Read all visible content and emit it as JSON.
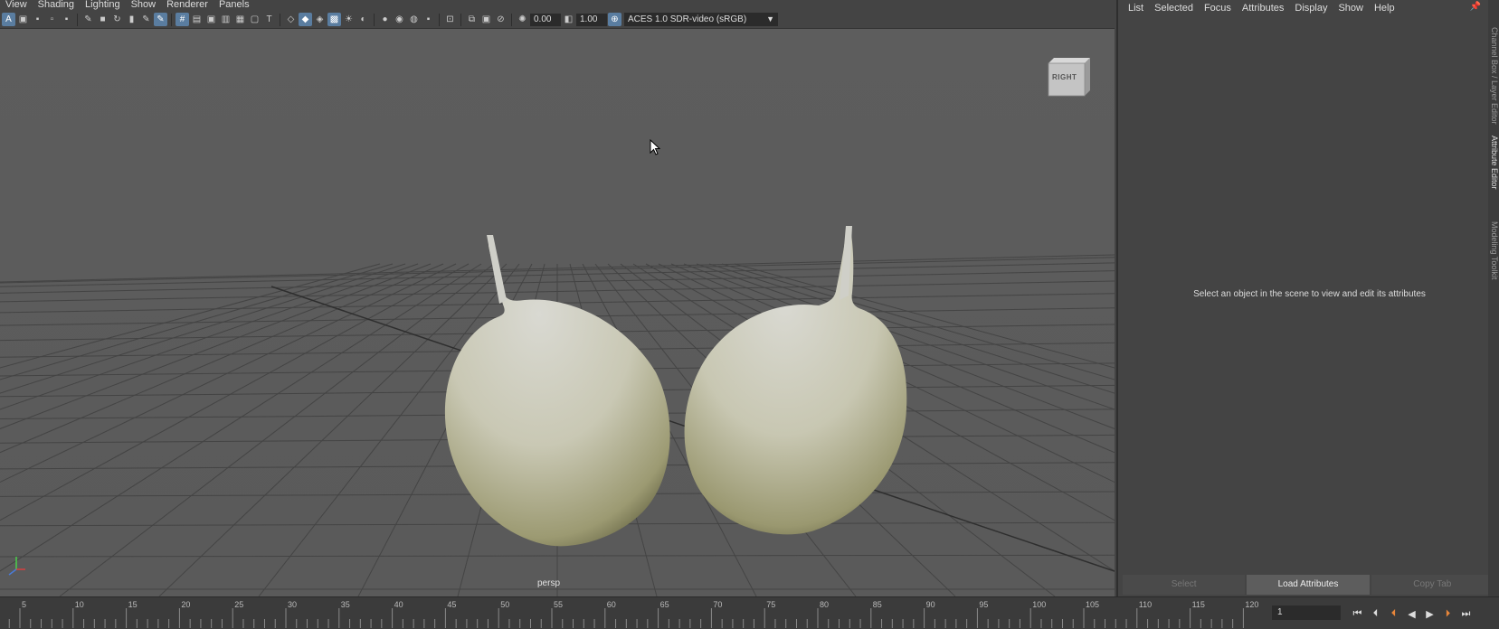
{
  "viewport": {
    "menu": [
      "View",
      "Shading",
      "Lighting",
      "Show",
      "Renderer",
      "Panels"
    ],
    "exposure_value": "0.00",
    "gamma_value": "1.00",
    "colorspace": "ACES 1.0 SDR-video (sRGB)",
    "camera_label": "persp",
    "viewcube_label": "RIGHT"
  },
  "attribute_editor": {
    "menu": [
      "List",
      "Selected",
      "Focus",
      "Attributes",
      "Display",
      "Show",
      "Help"
    ],
    "message": "Select an object in the scene to view and edit its attributes",
    "buttons": [
      "Select",
      "Load Attributes",
      "Copy Tab"
    ],
    "side_tabs": [
      "Channel Box / Layer Editor",
      "Attribute Editor",
      "Modeling Toolkit"
    ]
  },
  "time_slider": {
    "tick_labels": [
      "5",
      "10",
      "15",
      "20",
      "25",
      "30",
      "35",
      "40",
      "45",
      "50",
      "55",
      "60",
      "65",
      "70",
      "75",
      "80",
      "85",
      "90",
      "95",
      "100",
      "105",
      "110",
      "115",
      "120"
    ],
    "current_frame": "1"
  },
  "colors": {
    "viewport_bg": "#5d5d5d",
    "grid_line": "#3a3a3a",
    "object_light": "#d6d6cc",
    "object_dark": "#7f7f55",
    "active_button": "#5a7da0",
    "playhead_accent": "#e8863a"
  },
  "icons": {
    "toolbar": [
      "select-camera-icon",
      "camera-attributes-icon",
      "bookmarks-icon",
      "image-plane-icon",
      "2d-pan-zoom-icon",
      "grease-pencil-icon",
      "grid-icon",
      "film-gate-icon",
      "resolution-gate-icon",
      "gate-mask-icon",
      "field-chart-icon",
      "safe-action-icon",
      "safe-title-icon",
      "wireframe-icon",
      "smooth-shade-icon",
      "wireframe-on-shaded-icon",
      "textured-icon",
      "use-all-lights-icon",
      "shadows-icon",
      "screen-space-ao-icon",
      "motion-blur-icon",
      "multisample-aa-icon",
      "depth-of-field-icon",
      "isolate-select-icon",
      "xray-icon",
      "xray-joints-icon",
      "backface-culling-icon",
      "exposure-icon",
      "gamma-icon",
      "color-management-icon"
    ],
    "playback": [
      "go-to-start-icon",
      "step-back-key-icon",
      "step-back-frame-icon",
      "play-backwards-icon",
      "play-forwards-icon",
      "step-forward-frame-icon",
      "go-to-end-icon"
    ]
  }
}
